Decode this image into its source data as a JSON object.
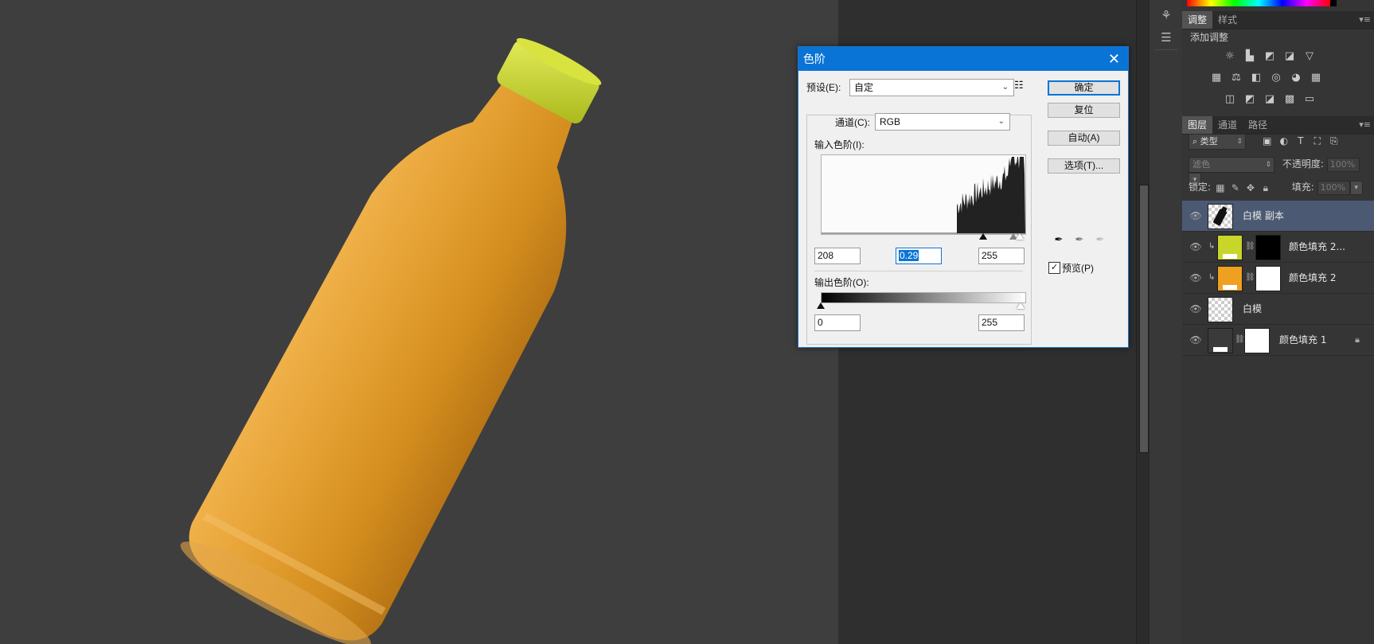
{
  "dialog": {
    "title": "色阶",
    "preset_label": "预设(E):",
    "preset_value": "自定",
    "channel_label": "通道(C):",
    "channel_value": "RGB",
    "input_levels_label": "输入色阶(I):",
    "input_black": "208",
    "input_gamma": "0.29",
    "input_white": "255",
    "output_levels_label": "输出色阶(O):",
    "output_black": "0",
    "output_white": "255",
    "buttons": {
      "ok": "确定",
      "reset": "复位",
      "auto": "自动(A)",
      "options": "选项(T)..."
    },
    "preview_label": "预览(P)",
    "preview_checked": true
  },
  "adjustments_panel": {
    "tabs": [
      "调整",
      "样式"
    ],
    "title": "添加调整"
  },
  "layers_panel": {
    "tabs": [
      "图层",
      "通道",
      "路径"
    ],
    "filter_kind": "类型",
    "blend_mode": "滤色",
    "opacity_label": "不透明度:",
    "opacity_value": "100%",
    "lock_label": "锁定:",
    "fill_label": "填充:",
    "fill_value": "100%",
    "layers": [
      {
        "name": "白模 副本",
        "selected": true
      },
      {
        "name": "颜色填充 2...",
        "fill_color": "#c8d62a"
      },
      {
        "name": "颜色填充 2",
        "fill_color": "#f0a020"
      },
      {
        "name": "白模"
      },
      {
        "name": "颜色填充 1",
        "fill_color": "#3a3a3a"
      }
    ]
  },
  "colors": {
    "canvas_bg": "#3e3e3e",
    "bottle_body": "#d8921e",
    "bottle_cap": "#c9d72b",
    "dialog_accent": "#0a74d6"
  }
}
